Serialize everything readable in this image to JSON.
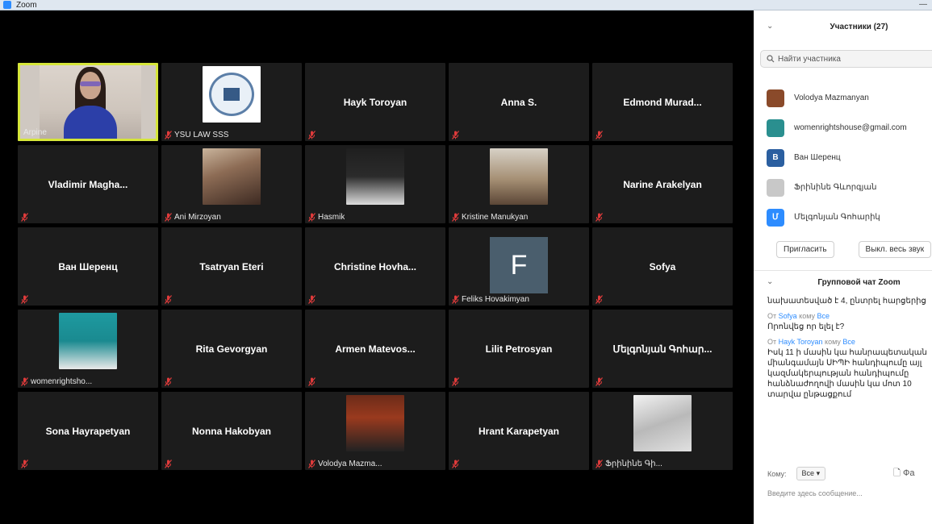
{
  "window": {
    "title": "Zoom"
  },
  "tiles": [
    {
      "name": "Arpine",
      "kind": "video",
      "active": true,
      "show_name": false
    },
    {
      "name": "YSU LAW SSS",
      "kind": "logo",
      "show_name": false
    },
    {
      "name": "Hayk Toroyan",
      "kind": "name"
    },
    {
      "name": "Anna S.",
      "kind": "name"
    },
    {
      "name": "Edmond Murad...",
      "kind": "name"
    },
    {
      "name": "Vladimir Magha...",
      "kind": "name"
    },
    {
      "name": "Ani Mirzoyan",
      "kind": "photo",
      "photo": "ph-person1"
    },
    {
      "name": "Hasmik",
      "kind": "photo",
      "photo": "ph-person2"
    },
    {
      "name": "Kristine Manukyan",
      "kind": "photo",
      "photo": "ph-person3"
    },
    {
      "name": "Narine Arakelyan",
      "kind": "name"
    },
    {
      "name": "Ван Шеренц",
      "kind": "name"
    },
    {
      "name": "Tsatryan Eteri",
      "kind": "name"
    },
    {
      "name": "Christine Hovha...",
      "kind": "name"
    },
    {
      "name": "Feliks Hovakimyan",
      "kind": "letter",
      "letter": "F"
    },
    {
      "name": "Sofya",
      "kind": "name"
    },
    {
      "name": "womenrightsho...",
      "kind": "photo",
      "photo": "ph-person4"
    },
    {
      "name": "Rita Gevorgyan",
      "kind": "name"
    },
    {
      "name": "Armen Matevos...",
      "kind": "name"
    },
    {
      "name": "Lilit Petrosyan",
      "kind": "name"
    },
    {
      "name": "Մելգոնյան Գոհար...",
      "kind": "name"
    },
    {
      "name": "Sona Hayrapetyan",
      "kind": "name"
    },
    {
      "name": "Nonna Hakobyan",
      "kind": "name"
    },
    {
      "name": "Volodya Mazma...",
      "kind": "photo",
      "photo": "ph-person5"
    },
    {
      "name": "Hrant Karapetyan",
      "kind": "name"
    },
    {
      "name": "Ֆրինինե Գի...",
      "kind": "photo",
      "photo": "ph-person6"
    }
  ],
  "sidebar": {
    "participants_title": "Участники (27)",
    "search_placeholder": "Найти участника",
    "participants": [
      {
        "name": "Volodya Mazmanyan",
        "color": "#8a4a2a",
        "initial": ""
      },
      {
        "name": "womenrightshouse@gmail.com",
        "color": "#2a8f8f",
        "initial": ""
      },
      {
        "name": "Ван Шеренц",
        "color": "#2b5fa0",
        "initial": "В"
      },
      {
        "name": "Ֆրինինե Գևորգյան",
        "color": "#c8c8c8",
        "initial": ""
      },
      {
        "name": "Մելգոնյան Գոհարիկ",
        "color": "#2d8cff",
        "initial": "Մ"
      }
    ],
    "invite_label": "Пригласить",
    "mute_all_label": "Выкл. весь звук",
    "chat_title": "Групповой чат Zoom",
    "chat_messages": [
      {
        "from": "",
        "to": "",
        "text": "նախատեսված է 4, ընտրել հարցերից"
      },
      {
        "from": "Sofya",
        "to": "Все",
        "text": "Որոնվեց որ ելել է?"
      },
      {
        "from": "Hayk Toroyan",
        "to": "Все",
        "text": "Իսկ 11 ի մասին կա հանրապետական միանգամայն ՍԻՊԻ հանդիպումը այլ կազմակերպության հանդիպումը հանձնաժողովի մասին կա մոտ 10 տարվա ընթացքում"
      }
    ],
    "chat_from_label": "От",
    "chat_to_label": "кому",
    "to_label": "Кому:",
    "to_value": "Все",
    "file_label": "Фа",
    "input_placeholder": "Введите здесь сообщение..."
  }
}
